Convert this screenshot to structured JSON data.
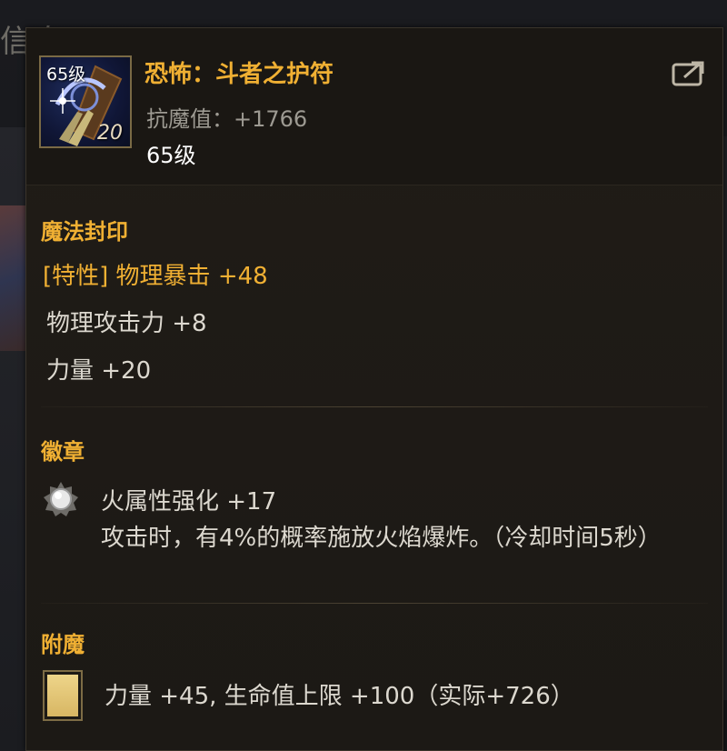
{
  "background": {
    "title_fragment": "信息"
  },
  "item": {
    "level_badge": "65级",
    "count": "20",
    "name": "恐怖：斗者之护符",
    "stat": "抗魔值：+1766",
    "level": "65级",
    "icon": "amulet-icon",
    "share_icon": "share-icon"
  },
  "magic_seal": {
    "label": "魔法封印",
    "lines": [
      "[特性] 物理暴击 +48",
      "物理攻击力 +8",
      "力量 +20"
    ]
  },
  "emblem": {
    "label": "徽章",
    "icon": "silver-emblem-icon",
    "title": "火属性强化 +17",
    "description": "攻击时，有4%的概率施放火焰爆炸。（冷却时间5秒）"
  },
  "enchant": {
    "label": "附魔",
    "icon": "gold-card-icon",
    "text": "力量 +45, 生命值上限 +100（实际+726）"
  },
  "colors": {
    "accent_gold": "#f0b033",
    "text": "#dcd8cf",
    "muted": "#9d9a92",
    "panel": "#1c1915"
  }
}
